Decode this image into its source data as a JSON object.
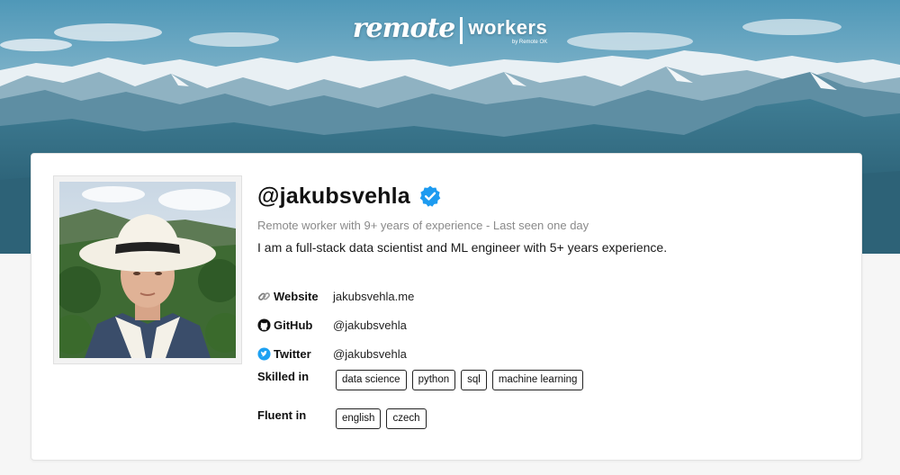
{
  "logo": {
    "remote": "remote",
    "workers": "workers",
    "by": "by Remote OK"
  },
  "profile": {
    "handle": "@jakubsvehla",
    "verified_icon": "verified-badge-icon",
    "subtitle": "Remote worker with 9+ years of experience - Last seen one day",
    "bio": "I am a full-stack data scientist and ML engineer with 5+ years experience."
  },
  "links": [
    {
      "icon": "link-icon",
      "label": "Website",
      "value": "jakubsvehla.me"
    },
    {
      "icon": "github-icon",
      "label": "GitHub",
      "value": "@jakubsvehla"
    },
    {
      "icon": "twitter-icon",
      "label": "Twitter",
      "value": "@jakubsvehla"
    }
  ],
  "skills": {
    "label": "Skilled in",
    "tags": [
      "data science",
      "python",
      "sql",
      "machine learning"
    ]
  },
  "languages": {
    "label": "Fluent in",
    "tags": [
      "english",
      "czech"
    ]
  },
  "colors": {
    "verified": "#1d9bf0",
    "twitter": "#1da1f2",
    "sky_top": "#4a94b5",
    "mountain_snow": "#eef3f6"
  }
}
